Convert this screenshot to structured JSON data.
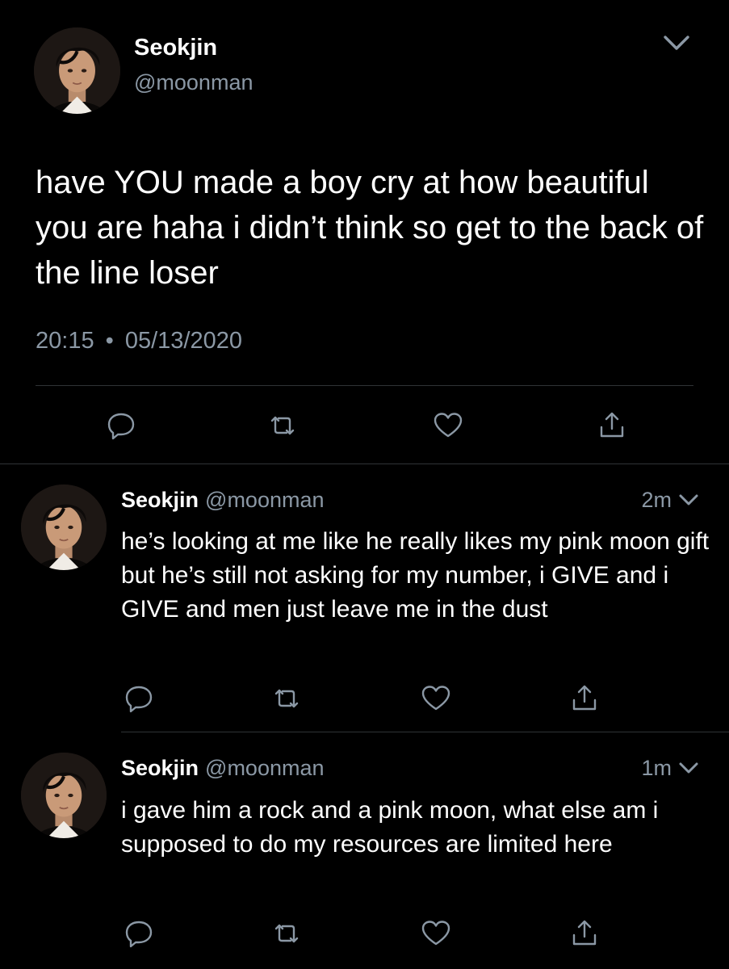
{
  "main_tweet": {
    "name": "Seokjin",
    "handle": "@moonman",
    "text": "have YOU made a boy cry at how beautiful you are haha i didn’t think so get to the back of the line loser",
    "time": "20:15",
    "separator": "•",
    "date": "05/13/2020",
    "menu_icon": "chevron-down-icon"
  },
  "replies": [
    {
      "name": "Seokjin",
      "handle": "@moonman",
      "time": "2m",
      "text": "he’s looking at me like he really likes my pink moon gift but he’s still not asking for my number, i GIVE and i GIVE and men just leave me in the dust"
    },
    {
      "name": "Seokjin",
      "handle": "@moonman",
      "time": "1m",
      "text": "i gave him a rock and a pink moon, what else am i supposed to do my resources are limited here"
    }
  ],
  "actions": [
    "reply-icon",
    "retweet-icon",
    "like-icon",
    "share-icon"
  ],
  "colors": {
    "background": "#000000",
    "text": "#ffffff",
    "secondary": "#8b98a5",
    "divider": "#2f3336"
  }
}
